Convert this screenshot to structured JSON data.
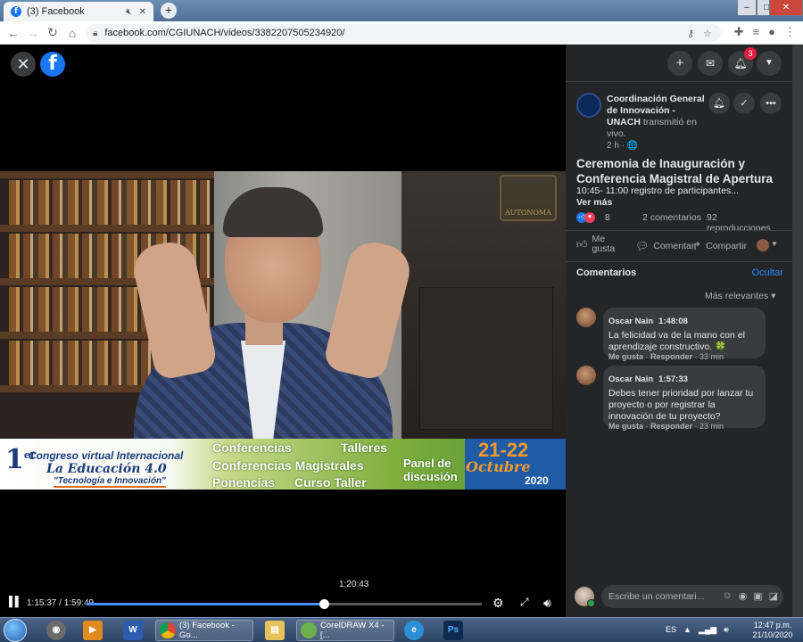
{
  "browser": {
    "tab_title": "(3) Facebook",
    "tab_audio_icon": "speaker-mute-icon",
    "url": "facebook.com/CGIUNACH/videos/3382207505234920/",
    "window_controls": [
      "–",
      "□",
      "✕"
    ]
  },
  "video": {
    "progress_fraction": 0.6,
    "current_time": "1:15:37 / 1:59:49",
    "hover_time": "1:20:43",
    "crest_text": "AUTONOMA",
    "banner": {
      "first": "1",
      "first_sup": "er",
      "line1": "Congreso virtual Internacional",
      "line2": "La Educación 4.0",
      "line3": "\"Tecnología e Innovación\"",
      "items": [
        "Conferencias",
        "Talleres",
        "Conferencias Magistrales",
        "Ponencias",
        "Curso Taller"
      ],
      "panel_line1": "Panel de",
      "panel_line2": "discusión",
      "dates": "21-22",
      "month": "Octubre",
      "year": "2020"
    }
  },
  "fb": {
    "notification_count": "3",
    "page_name": "Coordinación General de Innovación - UNACH",
    "page_action": "transmitió en vivo.",
    "post_time": "2 h · 🌐",
    "post_title": "Ceremonia de Inauguración y Conferencia Magistral de Apertura",
    "post_desc": "10:45- 11:00 registro de participantes...",
    "see_more": "Ver más",
    "reaction_count": "8",
    "comment_count": "2 comentarios",
    "view_count": "92 reproducciones",
    "actions": {
      "like": "Me gusta",
      "comment": "Comentar",
      "share": "Compartir"
    },
    "comments_header": "Comentarios",
    "hide_label": "Ocultar",
    "sort_label": "Más relevantes",
    "comments": [
      {
        "author": "Oscar Nain",
        "time": "1:48:08",
        "text": "La felicidad va de la mano con el aprendizaje constructivo.",
        "emoji": "🍀",
        "like": "Me gusta",
        "reply": "Responder",
        "age": "33 min"
      },
      {
        "author": "Oscar Nain",
        "time": "1:57:33",
        "text": "Debes tener prioridad por lanzar tu proyecto o por registrar la innovación de tu proyecto?",
        "emoji": "",
        "like": "Me gusta",
        "reply": "Responder",
        "age": "23 min"
      }
    ],
    "composer_placeholder": "Escribe un comentari..."
  },
  "taskbar": {
    "apps": [
      {
        "label": "(3) Facebook - Go..."
      },
      {
        "label": "CorelDRAW X4 - [..."
      }
    ],
    "language": "ES",
    "time": "12:47 p.m.",
    "date": "21/10/2020"
  },
  "colors": {
    "fb_blue": "#1877f2",
    "panel_bg": "#242526",
    "bubble_bg": "#3a3b3c",
    "link_blue": "#2d88ff",
    "progress_blue": "#4b8df8"
  }
}
